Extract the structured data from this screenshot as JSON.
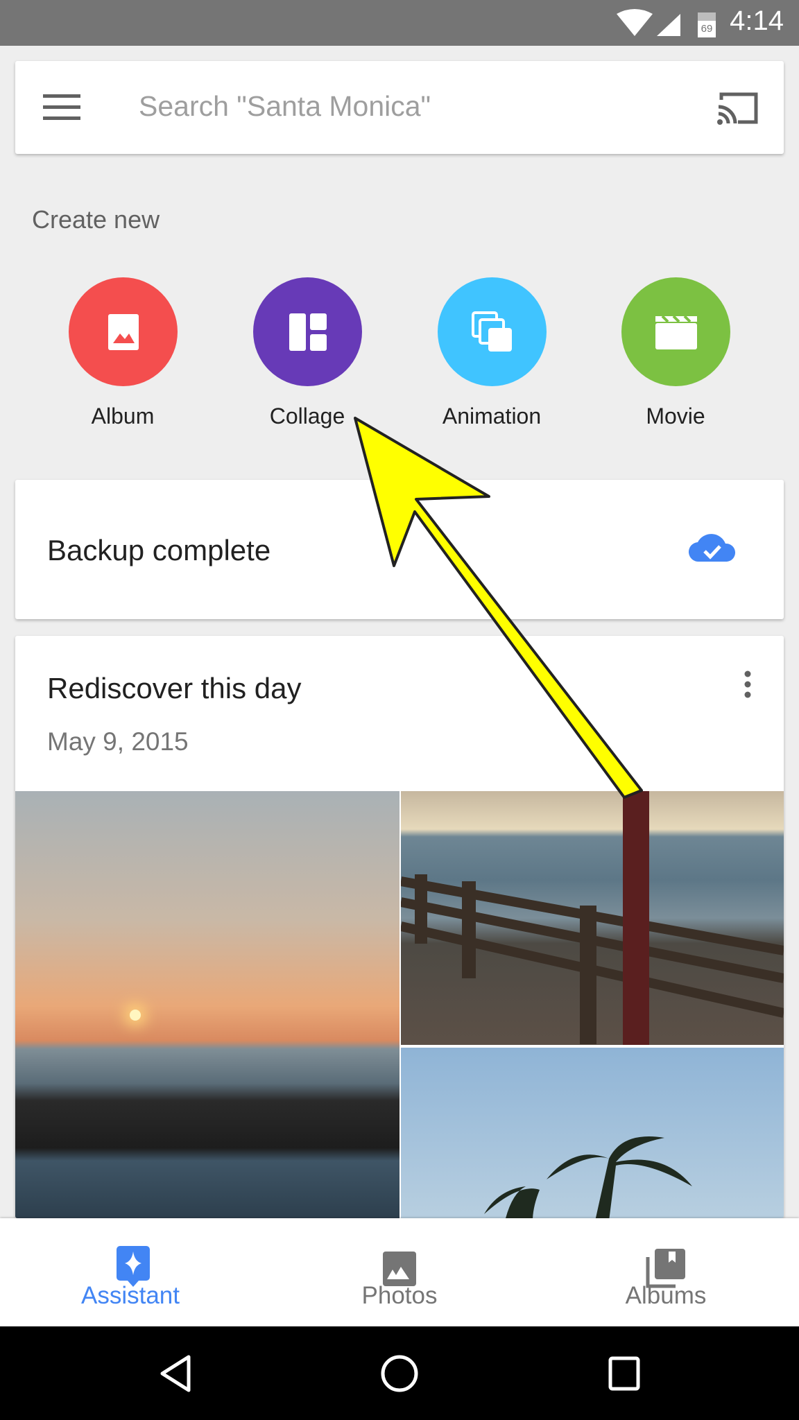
{
  "status_bar": {
    "battery": "69",
    "time": "4:14"
  },
  "search": {
    "placeholder": "Search \"Santa Monica\""
  },
  "create_new": {
    "title": "Create new",
    "items": [
      {
        "label": "Album",
        "color": "#f44e4e"
      },
      {
        "label": "Collage",
        "color": "#673ab7"
      },
      {
        "label": "Animation",
        "color": "#40c4ff"
      },
      {
        "label": "Movie",
        "color": "#7cc142"
      }
    ]
  },
  "backup": {
    "text": "Backup complete",
    "accent": "#4285f4"
  },
  "rediscover": {
    "title": "Rediscover this day",
    "date": "May 9, 2015"
  },
  "bottom_nav": {
    "items": [
      {
        "label": "Assistant",
        "active": true
      },
      {
        "label": "Photos"
      },
      {
        "label": "Albums"
      }
    ],
    "active_color": "#4285f4"
  },
  "annotation": {
    "arrow_color": "#ffff00"
  }
}
